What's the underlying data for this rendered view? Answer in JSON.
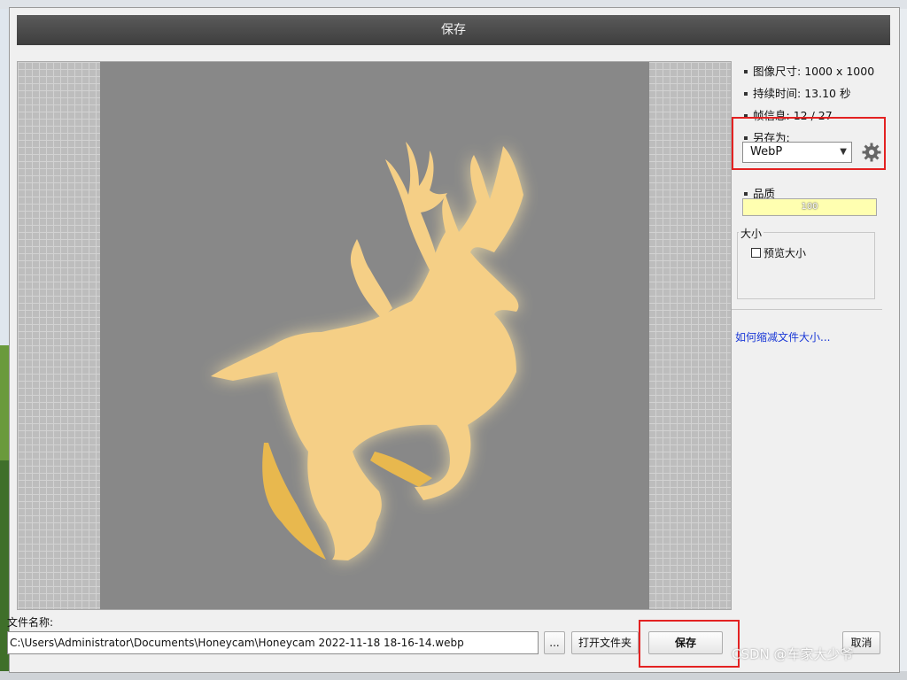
{
  "dialog": {
    "title": "保存"
  },
  "info": {
    "image_size_label": "图像尺寸:",
    "image_size_value": "1000 x 1000",
    "duration_label": "持续时间:",
    "duration_value": "13.10 秒",
    "frame_label": "帧信息:",
    "frame_value": "12 / 27",
    "saveas_label": "另存为:",
    "format_selected": "WebP",
    "quality_label": "品质",
    "quality_value": "100",
    "size_group_label": "大小",
    "preview_size_label": "预览大小",
    "help_link": "如何缩减文件大小..."
  },
  "file": {
    "name_label": "文件名称:",
    "path": "C:\\Users\\Administrator\\Documents\\Honeycam\\Honeycam 2022-11-18 18-16-14.webp"
  },
  "buttons": {
    "browse": "...",
    "open_folder": "打开文件夹",
    "save": "保存",
    "cancel": "取消"
  },
  "watermark": "CSDN @车家大少爷",
  "colors": {
    "accent_red": "#e32222",
    "deer": "#f5cf86",
    "link": "#1a38d6"
  }
}
